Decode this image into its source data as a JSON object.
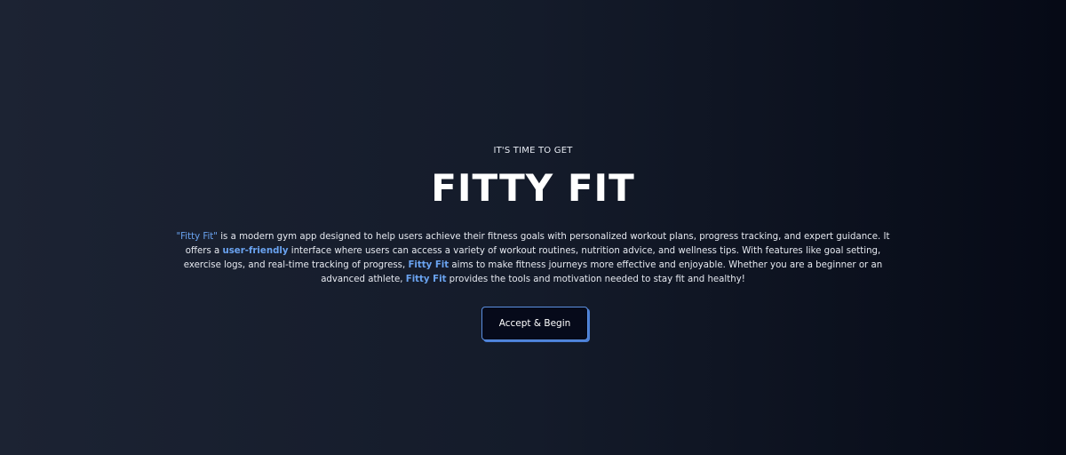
{
  "hero": {
    "eyebrow": "IT'S TIME TO GET",
    "title": "FITTY FIT",
    "description": {
      "p1_highlight": "\"Fitty Fit\"",
      "p1_text": " is a modern gym app designed to help users achieve their fitness goals with personalized workout plans, progress tracking, and expert guidance. It offers a ",
      "p2_highlight": "user-friendly",
      "p2_text": " interface where users can access a variety of workout routines, nutrition advice, and wellness tips. With features like goal setting, exercise logs, and real-time tracking of progress, ",
      "p3_highlight": "Fitty Fit",
      "p3_text": " aims to make fitness journeys more effective and enjoyable. Whether you are a beginner or an advanced athlete, ",
      "p4_highlight": "Fitty Fit",
      "p4_text": " provides the tools and motivation needed to stay fit and healthy!"
    },
    "cta_label": "Accept & Begin"
  },
  "colors": {
    "accent": "#6aa3f0",
    "background_dark": "#060a16",
    "background_mid": "#1c2333",
    "button_bg": "#060a1a"
  }
}
